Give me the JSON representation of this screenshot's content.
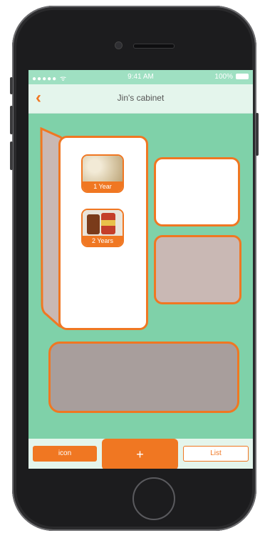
{
  "status_bar": {
    "signal": "●●●●● ᯤ",
    "time": "9:41 AM",
    "battery": "100%"
  },
  "nav": {
    "back_icon": "chevron-left-icon",
    "title": "Jin's cabinet"
  },
  "fridge": {
    "items": [
      {
        "name": "rice",
        "label": "1 Year"
      },
      {
        "name": "canned-goods",
        "label": "2 Years"
      }
    ]
  },
  "toolbar": {
    "icon_label": "icon",
    "add_label": "+",
    "list_label": "List"
  },
  "colors": {
    "background": "#7fd1a9",
    "accent": "#f07722",
    "navbar": "#e4f5ec"
  }
}
